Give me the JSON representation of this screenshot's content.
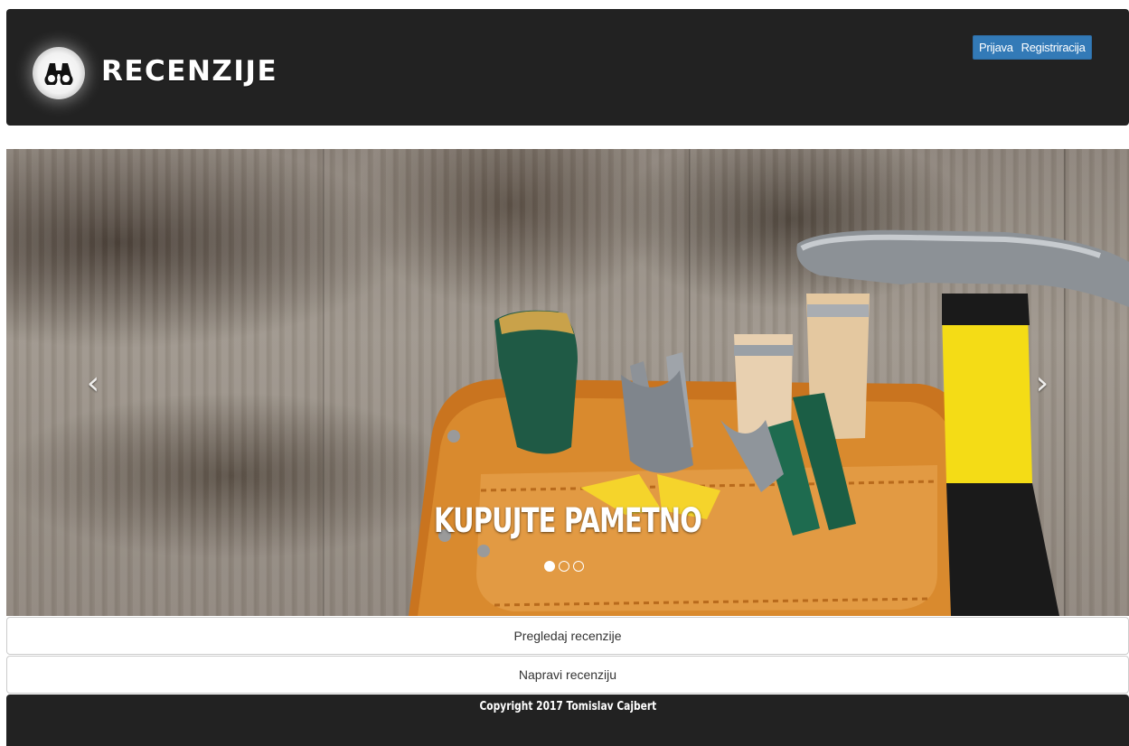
{
  "header": {
    "brand": "RECENZIJE",
    "logo_icon": "binoculars-icon",
    "auth": {
      "login_label": "Prijava",
      "register_label": "Registriracija"
    }
  },
  "carousel": {
    "caption": "KUPUJTE PAMETNO",
    "prev_icon": "‹",
    "next_icon": "›",
    "indicators": [
      {
        "active": true
      },
      {
        "active": false
      },
      {
        "active": false
      }
    ]
  },
  "actions": {
    "browse_label": "Pregledaj recenzije",
    "create_label": "Napravi recenziju"
  },
  "footer": {
    "copyright": "Copyright 2017 Tomislav Cajbert"
  },
  "colors": {
    "header_bg": "#222222",
    "auth_bg": "#337ab7",
    "page_bg": "#ffffff"
  }
}
